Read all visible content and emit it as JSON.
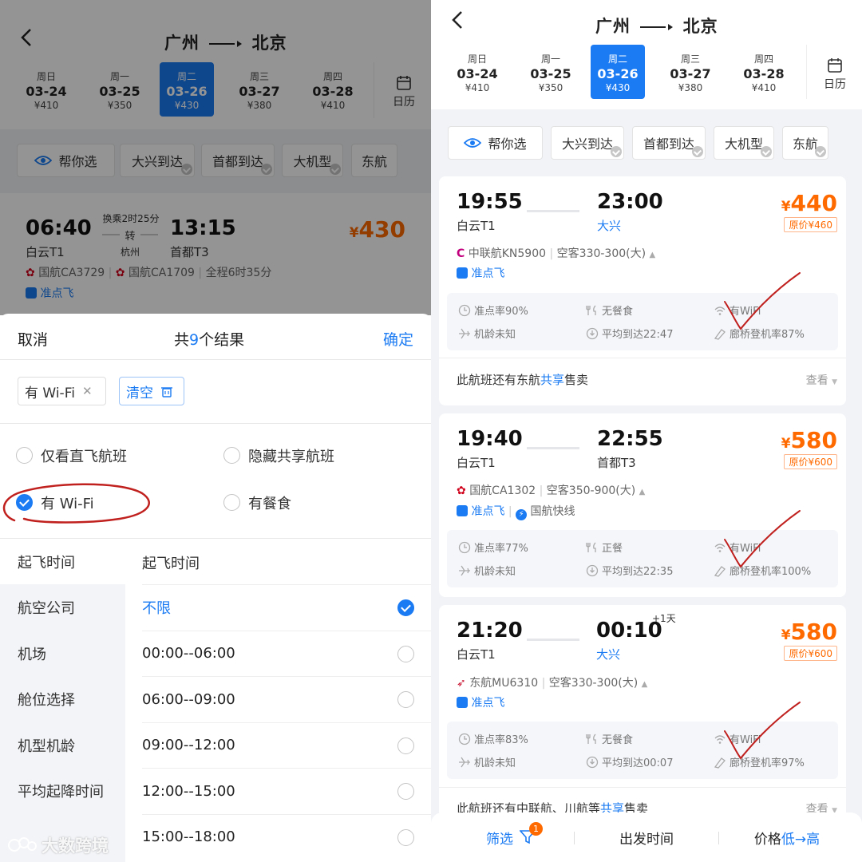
{
  "left": {
    "header": {
      "route_from": "广州",
      "route_to": "北京"
    },
    "dates": [
      {
        "weekday": "周日",
        "date": "03-24",
        "price": "¥410",
        "selected": false
      },
      {
        "weekday": "周一",
        "date": "03-25",
        "price": "¥350",
        "selected": false
      },
      {
        "weekday": "周二",
        "date": "03-26",
        "price": "¥430",
        "selected": true
      },
      {
        "weekday": "周三",
        "date": "03-27",
        "price": "¥380",
        "selected": false
      },
      {
        "weekday": "周四",
        "date": "03-28",
        "price": "¥410",
        "selected": false
      }
    ],
    "calendar_label": "日历",
    "chips": [
      "帮你选",
      "大兴到达",
      "首都到达",
      "大机型",
      "东航"
    ],
    "flight": {
      "dep_time": "06:40",
      "dep_airport": "白云T1",
      "transfer": "换乘2时25分",
      "transfer_mid": "转",
      "transfer_city": "杭州",
      "arr_time": "13:15",
      "arr_airport": "首都T3",
      "price_symbol": "¥",
      "price": "430",
      "leg1": "国航CA3729",
      "leg2": "国航CA1709",
      "duration": "全程6时35分",
      "ontime": "准点飞"
    },
    "sheet": {
      "cancel": "取消",
      "result_prefix": "共",
      "result_count": "9",
      "result_suffix": "个结果",
      "confirm": "确定",
      "selected_tag": "有 Wi-Fi",
      "clear": "清空",
      "options": {
        "direct": "仅看直飞航班",
        "hide_share": "隐藏共享航班",
        "wifi": "有 Wi-Fi",
        "meal": "有餐食"
      },
      "sidebar": [
        "起飞时间",
        "航空公司",
        "机场",
        "舱位选择",
        "机型机龄",
        "平均起降时间"
      ],
      "time_header": "起飞时间",
      "time_options": [
        "不限",
        "00:00--06:00",
        "06:00--09:00",
        "09:00--12:00",
        "12:00--15:00",
        "15:00--18:00"
      ]
    },
    "watermark": "大数跨境"
  },
  "right": {
    "header": {
      "route_from": "广州",
      "route_to": "北京"
    },
    "dates": [
      {
        "weekday": "周日",
        "date": "03-24",
        "price": "¥410",
        "selected": false
      },
      {
        "weekday": "周一",
        "date": "03-25",
        "price": "¥350",
        "selected": false
      },
      {
        "weekday": "周二",
        "date": "03-26",
        "price": "¥430",
        "selected": true
      },
      {
        "weekday": "周三",
        "date": "03-27",
        "price": "¥380",
        "selected": false
      },
      {
        "weekday": "周四",
        "date": "03-28",
        "price": "¥410",
        "selected": false
      }
    ],
    "calendar_label": "日历",
    "chips": [
      "帮你选",
      "大兴到达",
      "首都到达",
      "大机型",
      "东航"
    ],
    "flights": [
      {
        "dep_time": "19:55",
        "dep_airport": "白云T1",
        "arr_time": "23:00",
        "arr_airport": "大兴",
        "arr_plus": "",
        "price_symbol": "¥",
        "price": "440",
        "orig_price": "原价¥460",
        "airline": "中联航KN5900",
        "aircraft": "空客330-300(大)",
        "tags": [
          "准点飞"
        ],
        "ontime_rate": "准点率90%",
        "meal": "无餐食",
        "wifi": "有WiFi",
        "age": "机龄未知",
        "avg_arrival": "平均到达22:47",
        "bridge": "廊桥登机率87%",
        "share_prefix": "此航班还有东航",
        "share_hl": "共享",
        "share_suffix": "售卖",
        "view": "查看"
      },
      {
        "dep_time": "19:40",
        "dep_airport": "白云T1",
        "arr_time": "22:55",
        "arr_airport": "首都T3",
        "arr_plus": "",
        "price_symbol": "¥",
        "price": "580",
        "orig_price": "原价¥600",
        "airline": "国航CA1302",
        "aircraft": "空客350-900(大)",
        "tags": [
          "准点飞",
          "国航快线"
        ],
        "ontime_rate": "准点率77%",
        "meal": "正餐",
        "wifi": "有WiFi",
        "age": "机龄未知",
        "avg_arrival": "平均到达22:35",
        "bridge": "廊桥登机率100%"
      },
      {
        "dep_time": "21:20",
        "dep_airport": "白云T1",
        "arr_time": "00:10",
        "arr_airport": "大兴",
        "arr_plus": "+1天",
        "price_symbol": "¥",
        "price": "580",
        "orig_price": "原价¥600",
        "airline": "东航MU6310",
        "aircraft": "空客330-300(大)",
        "tags": [
          "准点飞"
        ],
        "ontime_rate": "准点率83%",
        "meal": "无餐食",
        "wifi": "有WiFi",
        "age": "机龄未知",
        "avg_arrival": "平均到达00:07",
        "bridge": "廊桥登机率97%",
        "share_prefix": "此航班还有中联航、川航等",
        "share_hl": "共享",
        "share_suffix": "售卖",
        "view": "查看"
      }
    ],
    "bottom_bar": {
      "filter": "筛选",
      "filter_badge": "1",
      "departure": "出发时间",
      "price_prefix": "价格",
      "price_order": "低→高"
    }
  },
  "colors": {
    "accent": "#1b7bf3",
    "price": "#ff6a00",
    "annotation": "#c0201e"
  },
  "icons": [
    "back-arrow-icon",
    "calendar-icon",
    "eye-icon",
    "clear-icon",
    "clock-icon",
    "meal-icon",
    "wifi-icon",
    "plane-icon",
    "arrival-clock-icon",
    "jetbridge-icon",
    "filter-icon"
  ]
}
